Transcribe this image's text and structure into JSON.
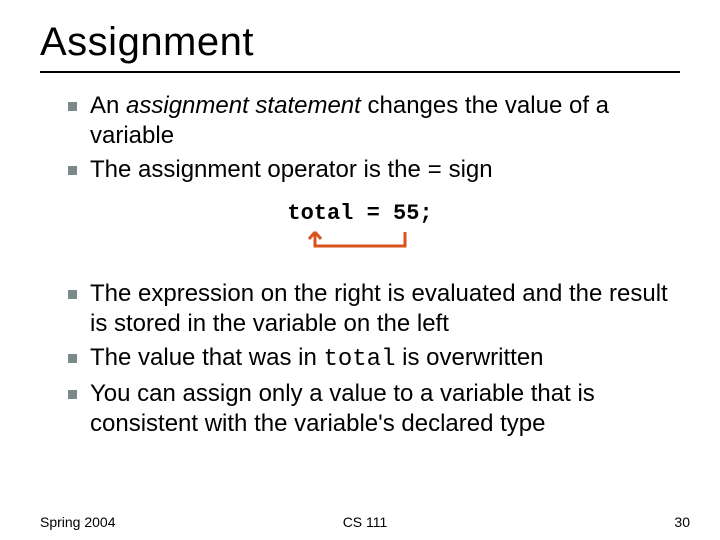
{
  "title": "Assignment",
  "bullets1": {
    "item0": {
      "pre": "An ",
      "em": "assignment statement",
      "post": " changes the value of a variable"
    },
    "item1": {
      "pre": "The assignment operator is the ",
      "eq": "=",
      "post": " sign"
    }
  },
  "code": "total = 55;",
  "bullets2": {
    "item0": "The expression on the right is evaluated and the result is stored in the variable on the left",
    "item1": {
      "pre": "The value that was in ",
      "code": "total",
      "post": " is overwritten"
    }
  },
  "bullets3": {
    "item0": "You can assign only a value to a variable that is consistent with the variable's declared type"
  },
  "footer": {
    "left": "Spring 2004",
    "center": "CS 111",
    "right": "30"
  }
}
